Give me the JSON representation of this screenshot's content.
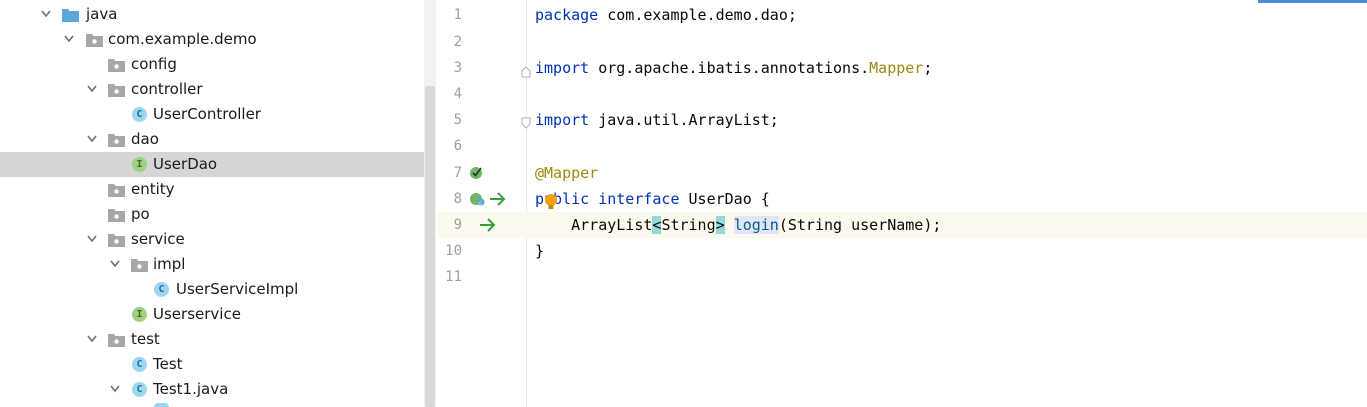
{
  "project_tree": {
    "items": [
      {
        "label": "java",
        "icon": "source-folder-icon",
        "expanded": true
      },
      {
        "label": "com.example.demo",
        "icon": "package-icon",
        "expanded": true
      },
      {
        "label": "config",
        "icon": "package-icon"
      },
      {
        "label": "controller",
        "icon": "package-icon",
        "expanded": true
      },
      {
        "label": "UserController",
        "icon": "class-icon",
        "badge": "C"
      },
      {
        "label": "dao",
        "icon": "package-icon",
        "expanded": true
      },
      {
        "label": "UserDao",
        "icon": "interface-icon",
        "badge": "I",
        "selected": true
      },
      {
        "label": "entity",
        "icon": "package-icon"
      },
      {
        "label": "po",
        "icon": "package-icon"
      },
      {
        "label": "service",
        "icon": "package-icon",
        "expanded": true
      },
      {
        "label": "impl",
        "icon": "package-icon",
        "expanded": true
      },
      {
        "label": "UserServiceImpl",
        "icon": "class-icon",
        "badge": "C"
      },
      {
        "label": "Userservice",
        "icon": "interface-icon",
        "badge": "I"
      },
      {
        "label": "test",
        "icon": "package-icon",
        "expanded": true
      },
      {
        "label": "Test",
        "icon": "class-icon",
        "badge": "C"
      },
      {
        "label": "Test1.java",
        "icon": "class-icon",
        "badge": "C",
        "expanded": true
      }
    ]
  },
  "editor": {
    "line_numbers": [
      "1",
      "2",
      "3",
      "4",
      "5",
      "6",
      "7",
      "8",
      "9",
      "10",
      "11"
    ],
    "current_line": "9",
    "tokens": {
      "l1_kw": "package",
      "l1_rest": " com.example.demo.dao;",
      "l3_kw": "import",
      "l3_rest": " org.apache.ibatis.annotations.",
      "l3_ann": "Mapper",
      "l3_end": ";",
      "l5_kw": "import",
      "l5_rest": " java.util.ArrayList;",
      "l7_ann": "@Mapper",
      "l8_kw1": "public",
      "l8_kw2": "interface",
      "l8_rest": " UserDao {",
      "l9_indent": "    ArrayList",
      "l9_lt": "<",
      "l9_type": "String",
      "l9_gt": ">",
      "l9_fn": "login",
      "l9_args": "(String userName);",
      "l10": "}"
    }
  },
  "colors": {
    "keyword": "#0033b3",
    "annotation": "#9e880d",
    "method": "#00627a",
    "bracket_highlight": "#93d9d9",
    "current_line": "#fcfaed",
    "selected_row": "#d5d5d5",
    "class_icon": "#9dd6ee",
    "interface_icon": "#9fcf7f",
    "implementation_arrow": "#3a9c3a"
  }
}
